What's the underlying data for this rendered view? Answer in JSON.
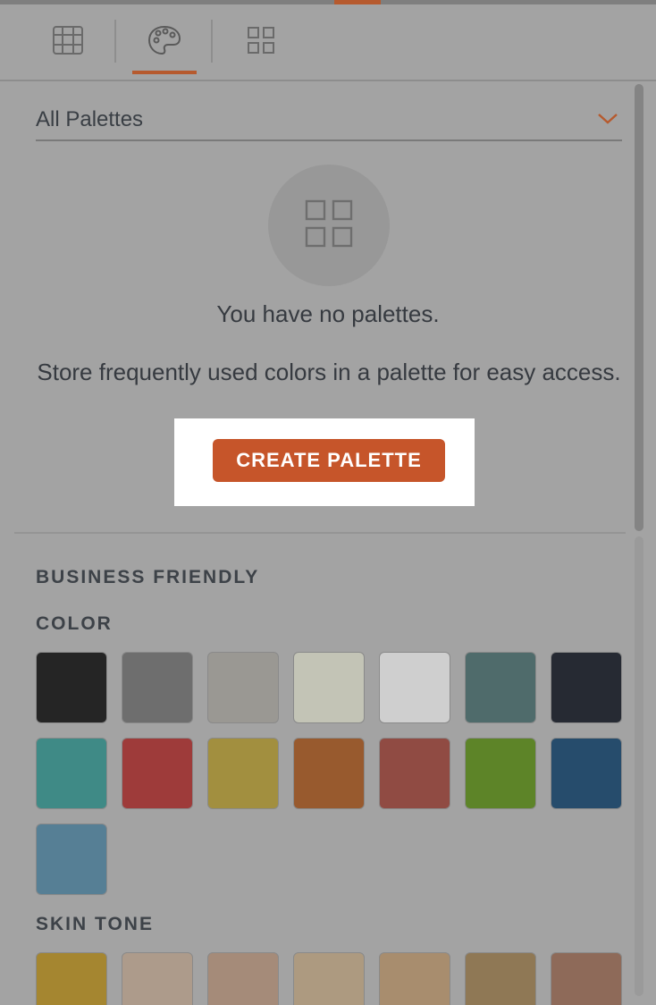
{
  "toolbar": {
    "tabs": [
      {
        "name": "grid",
        "icon": "table-grid-icon",
        "active": false
      },
      {
        "name": "palette",
        "icon": "palette-icon",
        "active": true
      },
      {
        "name": "layout",
        "icon": "four-squares-icon",
        "active": false
      }
    ]
  },
  "palette_select": {
    "value": "All Palettes",
    "icon": "chevron-down-icon"
  },
  "empty_state": {
    "icon": "four-squares-icon",
    "title": "You have no palettes.",
    "description": "Store frequently used colors in a palette for easy access."
  },
  "create_button": {
    "label": "CREATE PALETTE"
  },
  "sections": {
    "group_title": "BUSINESS FRIENDLY",
    "color": {
      "label": "COLOR",
      "swatches": [
        "#252525",
        "#6e6e6e",
        "#9a9893",
        "#c3c4b6",
        "#cfcfcf",
        "#4f6b6b",
        "#262a33",
        "#3f8a86",
        "#9e3b3a",
        "#a28f3f",
        "#985a2e",
        "#904b43",
        "#5d8428",
        "#264c6c",
        "#567f95"
      ]
    },
    "skin_tone": {
      "label": "SKIN TONE",
      "swatches": [
        "#a58630",
        "#ad9b8b",
        "#a58b79",
        "#ad9a80",
        "#a88d6e",
        "#8f7855",
        "#8e6a59"
      ]
    }
  },
  "colors": {
    "accent": "#c6552a",
    "background": "#a3a3a3",
    "highlight": "#ffffff"
  }
}
